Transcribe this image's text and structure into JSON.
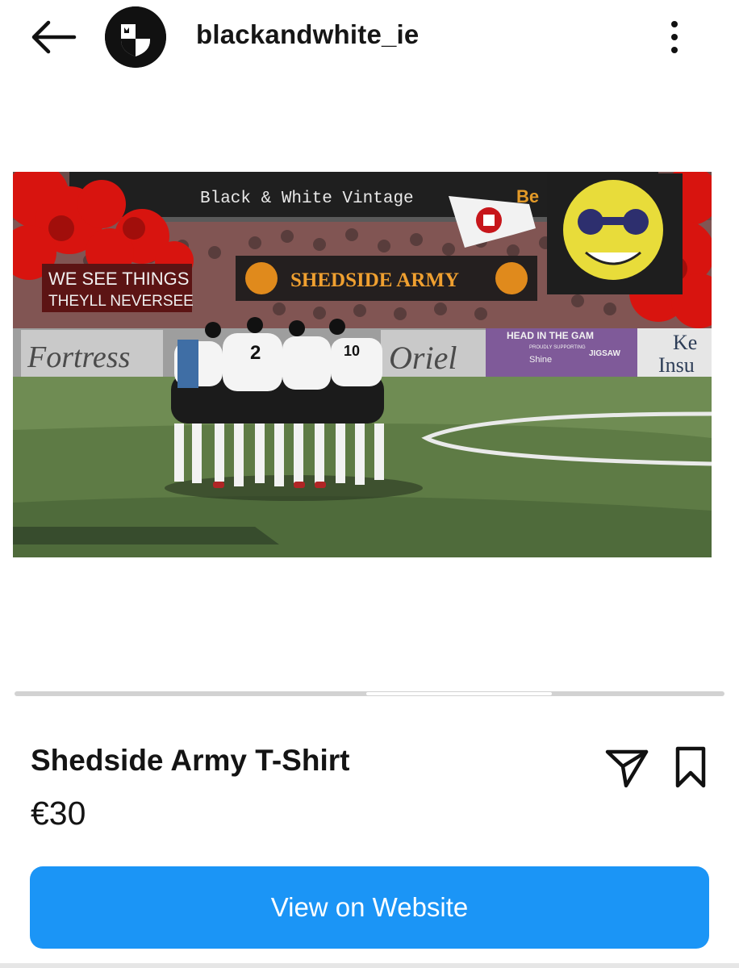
{
  "header": {
    "username": "blackandwhite_ie",
    "icons": {
      "back": "arrow-left-icon",
      "avatar": "club-crest-logo",
      "more": "more-vertical-icon"
    }
  },
  "artwork": {
    "banner_text": "Black & White Vintage",
    "sponsor_partial": "Be",
    "main_flag": "SHEDSIDE ARMY",
    "left_flag_line1": "WE SEE THINGS",
    "left_flag_line2": "THEYLL NEVERSEE",
    "ad_fortress": "Fortress",
    "ad_oriel": "Oriel",
    "ad_head": "HEAD IN THE GAM",
    "ad_head_small": "PROUDLY SUPPORTING",
    "ad_jigsaw": "JIGSAW",
    "ad_shine": "Shine",
    "ad_ke": "Ke",
    "ad_insu": "Insu",
    "player_number": "2",
    "player_number_2": "10",
    "colors": {
      "flare": "#d8140f",
      "grass": "#5e7b45",
      "banner": "#1f1f1f",
      "yellow_flag": "#e8dc3a"
    }
  },
  "product": {
    "title": "Shedside Army T-Shirt",
    "price": "€30",
    "icons": {
      "share": "paper-plane-icon",
      "save": "bookmark-icon"
    }
  },
  "cta": {
    "label": "View on Website",
    "color": "#1b95f6"
  },
  "carousel": {
    "current_page": 2,
    "total_pages": 4
  }
}
